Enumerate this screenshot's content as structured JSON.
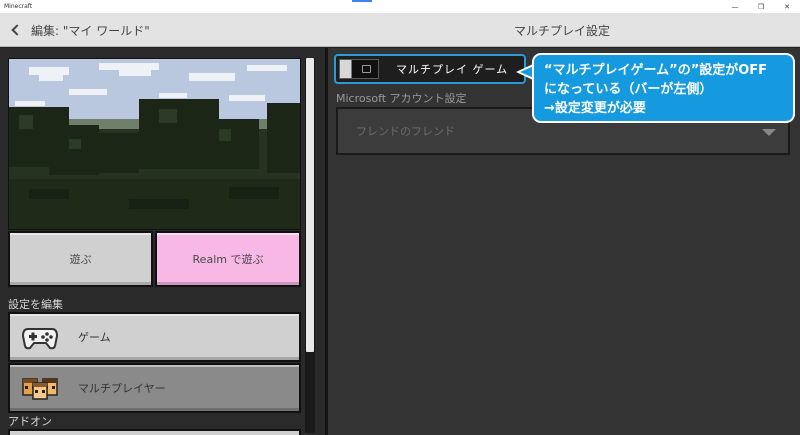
{
  "window": {
    "app_title": "Minecraft",
    "controls": {
      "minimize": "—",
      "maximize": "❐",
      "close": "✕"
    }
  },
  "header": {
    "back_label": "編集: \"マイ ワールド\"",
    "title": "マルチプレイ設定"
  },
  "left_panel": {
    "play_button": "遊ぶ",
    "realm_button": "Realm で遊ぶ",
    "edit_section_label": "設定を編集",
    "menu_items": [
      {
        "label": "ゲーム",
        "icon": "controller-icon",
        "selected": false
      },
      {
        "label": "マルチプレイヤー",
        "icon": "players-icon",
        "selected": true
      }
    ],
    "addon_section_label": "アドオン"
  },
  "right_panel": {
    "multiplayer_toggle": {
      "label": "マルチプレイ ゲーム",
      "state": "off"
    },
    "account_section_label": "Microsoft アカウント設定",
    "friends_dropdown": {
      "value": "フレンドのフレンド",
      "enabled": false
    }
  },
  "annotation": {
    "lines": [
      "“マルチプレイゲーム”の”設定がOFF",
      "になっている（バーが左側）",
      "→設定変更が必要"
    ]
  },
  "colors": {
    "accent_blue": "#159ae0",
    "toggle_border": "#2c9bd8",
    "realm_pink": "#f7b8e6",
    "button_gray": "#d0d0d0",
    "selected_gray": "#8a8a8a"
  }
}
